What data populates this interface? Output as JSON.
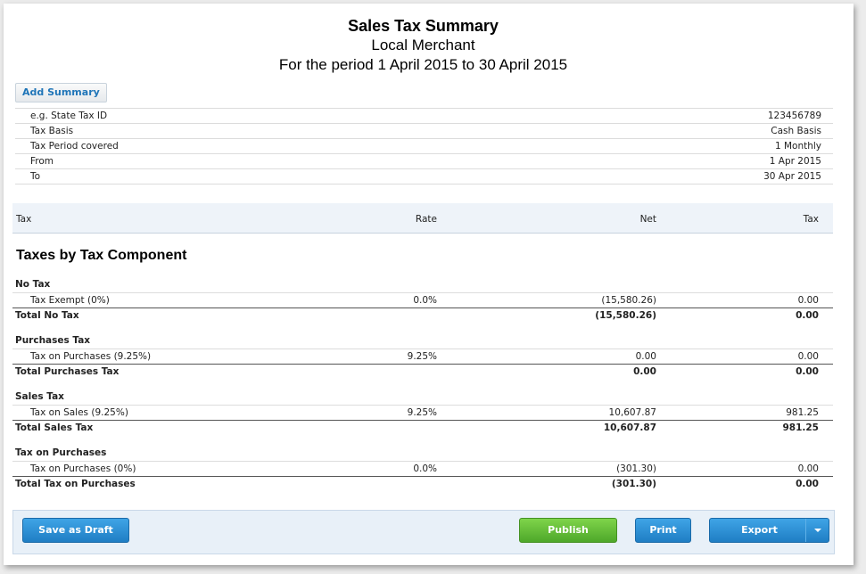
{
  "header": {
    "title": "Sales Tax Summary",
    "org": "Local Merchant",
    "period": "For the period 1 April 2015 to 30 April 2015"
  },
  "add_summary_label": "Add Summary",
  "meta": [
    {
      "key": "e.g. State Tax ID",
      "value": "123456789"
    },
    {
      "key": "Tax Basis",
      "value": "Cash Basis"
    },
    {
      "key": "Tax Period covered",
      "value": "1 Monthly"
    },
    {
      "key": "From",
      "value": "1 Apr 2015"
    },
    {
      "key": "To",
      "value": "30 Apr 2015"
    }
  ],
  "columns": {
    "tax": "Tax",
    "rate": "Rate",
    "net": "Net",
    "tax_amount": "Tax"
  },
  "section_title": "Taxes by Tax Component",
  "groups": [
    {
      "name": "No Tax",
      "line": {
        "name": "Tax Exempt (0%)",
        "rate": "0.0%",
        "net": "(15,580.26)",
        "tax": "0.00"
      },
      "total": {
        "name": "Total No Tax",
        "net": "(15,580.26)",
        "tax": "0.00"
      }
    },
    {
      "name": "Purchases Tax",
      "line": {
        "name": "Tax on Purchases (9.25%)",
        "rate": "9.25%",
        "net": "0.00",
        "tax": "0.00"
      },
      "total": {
        "name": "Total Purchases Tax",
        "net": "0.00",
        "tax": "0.00"
      }
    },
    {
      "name": "Sales Tax",
      "line": {
        "name": "Tax on Sales (9.25%)",
        "rate": "9.25%",
        "net": "10,607.87",
        "tax": "981.25"
      },
      "total": {
        "name": "Total Sales Tax",
        "net": "10,607.87",
        "tax": "981.25"
      }
    },
    {
      "name": "Tax on Purchases",
      "line": {
        "name": "Tax on Purchases (0%)",
        "rate": "0.0%",
        "net": "(301.30)",
        "tax": "0.00"
      },
      "total": {
        "name": "Total Tax on Purchases",
        "net": "(301.30)",
        "tax": "0.00"
      }
    }
  ],
  "actions": {
    "save_draft": "Save as Draft",
    "publish": "Publish",
    "print": "Print",
    "export": "Export"
  },
  "colors": {
    "blue_button": "#2b8fd6",
    "green_button": "#62c034",
    "link_blue": "#1f75b8",
    "header_bg": "#eef3f9"
  }
}
